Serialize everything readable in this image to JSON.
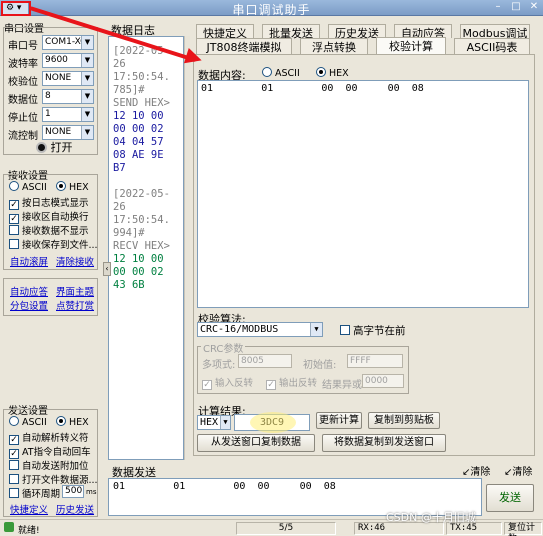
{
  "window": {
    "title": "串口调试助手",
    "system_menu": "⚙ ▾"
  },
  "serial_settings": {
    "group_title": "串口设置",
    "port_label": "串口号",
    "port_value": "COM1-XCO",
    "baud_label": "波特率",
    "baud_value": "9600",
    "parity_label": "校验位",
    "parity_value": "NONE",
    "databits_label": "数据位",
    "databits_value": "8",
    "stopbits_label": "停止位",
    "stopbits_value": "1",
    "flow_label": "流控制",
    "flow_value": "NONE",
    "open_label": "打开"
  },
  "receive_settings": {
    "group_title": "接收设置",
    "ascii_label": "ASCII",
    "hex_label": "HEX",
    "checks": [
      {
        "label": "按日志模式显示",
        "checked": true
      },
      {
        "label": "接收区自动换行",
        "checked": true
      },
      {
        "label": "接收数据不显示",
        "checked": false
      },
      {
        "label": "接收保存到文件...",
        "checked": false
      }
    ],
    "link1": "自动滚屏",
    "link2": "清除接收"
  },
  "shortcuts": {
    "link1": "自动应答",
    "link2": "界面主题",
    "link3": "分包设置",
    "link4": "点赞打赏"
  },
  "send_settings": {
    "group_title": "发送设置",
    "ascii_label": "ASCII",
    "hex_label": "HEX",
    "checks": [
      {
        "label": "自动解析转义符",
        "checked": true
      },
      {
        "label": "AT指令自动回车",
        "checked": true
      },
      {
        "label": "自动发送附加位",
        "checked": false
      },
      {
        "label": "打开文件数据源...",
        "checked": false
      },
      {
        "label": "循环周期",
        "checked": false
      }
    ],
    "cycle_value": "500",
    "cycle_unit": "ms",
    "link1": "快捷定义",
    "link2": "历史发送"
  },
  "data_log": {
    "title": "数据日志",
    "lines": [
      {
        "text": "[2022-05-",
        "cls": "gray"
      },
      {
        "text": "26",
        "cls": "gray"
      },
      {
        "text": "17:50:54.",
        "cls": "gray"
      },
      {
        "text": "785]#",
        "cls": "gray"
      },
      {
        "text": "SEND HEX>",
        "cls": "gray"
      },
      {
        "text": "12 10 00",
        "cls": "navy"
      },
      {
        "text": "00 00 02",
        "cls": "navy"
      },
      {
        "text": "04 04 57",
        "cls": "navy"
      },
      {
        "text": "08 AE 9E",
        "cls": "navy"
      },
      {
        "text": "B7",
        "cls": "navy"
      },
      {
        "text": "",
        "cls": "gray"
      },
      {
        "text": "[2022-05-",
        "cls": "gray"
      },
      {
        "text": "26",
        "cls": "gray"
      },
      {
        "text": "17:50:54.",
        "cls": "gray"
      },
      {
        "text": "994]#",
        "cls": "gray"
      },
      {
        "text": "RECV HEX>",
        "cls": "gray"
      },
      {
        "text": "12 10 00",
        "cls": "green"
      },
      {
        "text": "00 00 02",
        "cls": "green"
      },
      {
        "text": "43 6B",
        "cls": "green"
      }
    ]
  },
  "tabs": {
    "row1": [
      "快捷定义",
      "批量发送",
      "历史发送",
      "自动应答",
      "Modbus调试"
    ],
    "row2": [
      "JT808终端模拟",
      "浮点转换",
      "校验计算",
      "ASCII码表"
    ]
  },
  "checksum": {
    "data_label": "数据内容:",
    "ascii_label": "ASCII",
    "hex_label": "HEX",
    "data_value": "01        01        00  00     00  08",
    "algo_label": "校验算法:",
    "algo_value": "CRC-16/MODBUS",
    "high_byte_label": "高字节在前",
    "crc_group": "CRC参数",
    "poly_label": "多项式:",
    "poly_value": "8005",
    "init_label": "初始值:",
    "init_value": "FFFF",
    "refin_label": "输入反转",
    "refout_label": "输出反转",
    "xor_label": "结果异或",
    "xor_value": "0000",
    "result_label": "计算结果:",
    "result_format": "HEX",
    "result_value": "3DC9",
    "update_button": "更新计算",
    "copy_button": "复制到剪贴板",
    "from_send_button": "从发送窗口复制数据",
    "to_send_button": "将数据复制到发送窗口"
  },
  "send_area": {
    "title": "数据发送",
    "clear1": "清除",
    "clear2": "清除",
    "value": "01        01        00  00     00  08",
    "send_button": "发送"
  },
  "status_bar": {
    "connection": "就绪!",
    "pages": "5/5",
    "rx": "RX:46",
    "tx": "TX:45",
    "reset": "复位计数"
  },
  "watermark": "CSDN @十月旧城"
}
